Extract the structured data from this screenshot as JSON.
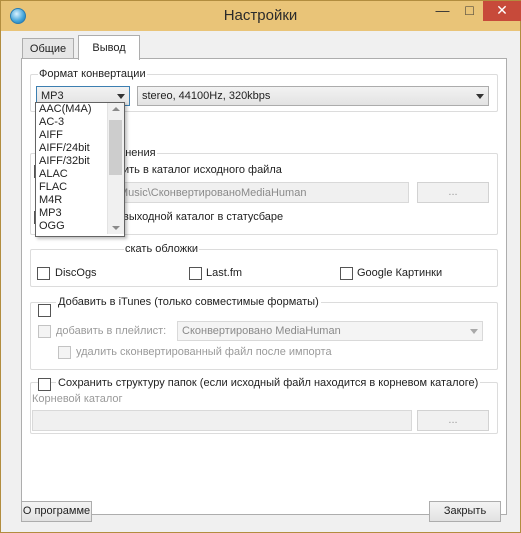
{
  "window": {
    "title": "Настройки",
    "minimize": "—",
    "maximize": "□",
    "close": "✕"
  },
  "tabs": [
    {
      "label": "Общие"
    },
    {
      "label": "Вывод"
    }
  ],
  "format": {
    "group_label": "Формат конвертации",
    "selected": "MP3",
    "quality": "stereo, 44100Hz, 320kbps",
    "options": [
      "AAC(M4A)",
      "AC-3",
      "AIFF",
      "AIFF/24bit",
      "AIFF/32bit",
      "ALAC",
      "FLAC",
      "M4R",
      "MP3",
      "OGG"
    ]
  },
  "save": {
    "group_label_partial": "ранения",
    "source_folder_partial": "ить в каталог исходного файла",
    "path_partial": "Music\\СконвертированоMediaHuman",
    "browse": "...",
    "statusbar_partial": "выходной каталог в статусбаре"
  },
  "covers": {
    "group_label_partial": "скать обложки",
    "discogs": "DiscOgs",
    "lastfm": "Last.fm",
    "google": "Google Картинки"
  },
  "itunes": {
    "add_label": "Добавить в iTunes (только совместимые форматы)",
    "playlist_label": "добавить в плейлист:",
    "playlist_value": "Сконвертировано MediaHuman",
    "delete_label": "удалить сконвертированный файл после импорта"
  },
  "structure": {
    "keep_label": "Сохранить структуру папок (если исходный файл находится в корневом каталоге)",
    "root_label": "Корневой каталог",
    "root_value": "",
    "browse": "..."
  },
  "footer": {
    "about": "О программе",
    "close": "Закрыть"
  }
}
